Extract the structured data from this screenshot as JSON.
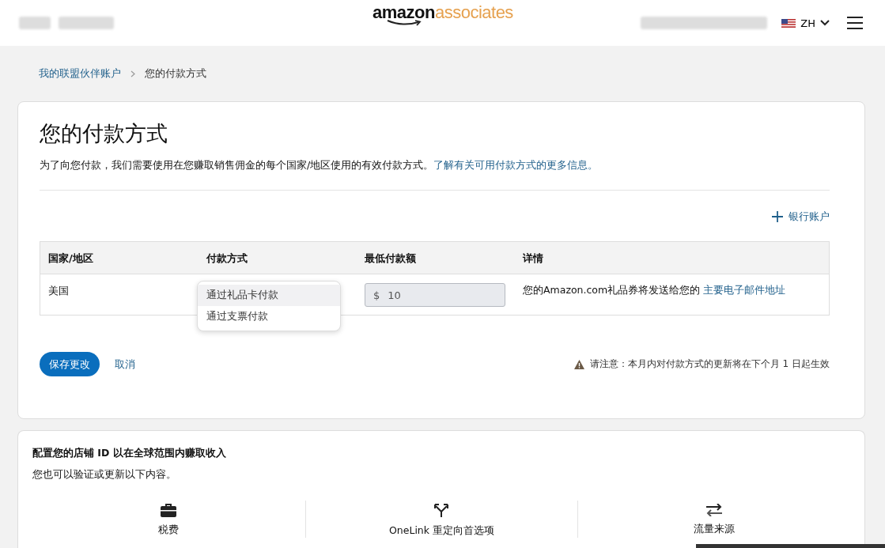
{
  "header": {
    "logo": {
      "brand": "amazon",
      "product": "associates"
    },
    "language": "ZH"
  },
  "breadcrumb": [
    {
      "label": "我的联盟伙伴账户",
      "link": true
    },
    {
      "label": "您的付款方式",
      "link": false
    }
  ],
  "payment_card": {
    "title": "您的付款方式",
    "intro": "为了向您付款，我们需要使用在您赚取销售佣金的每个国家/地区使用的有效付款方式。",
    "intro_link": "了解有关可用付款方式的更多信息。",
    "add_button": "银行账户",
    "table": {
      "columns": [
        "国家/地区",
        "付款方式",
        "最低付款额",
        "详情"
      ],
      "rows": [
        {
          "country": "美国",
          "payment_options": [
            {
              "label": "通过礼品卡付款",
              "selected": true
            },
            {
              "label": "通过支票付款",
              "selected": false
            }
          ],
          "currency": "$",
          "minimum": "10",
          "details": "您的Amazon.com礼品券将发送给您的",
          "details_link": "主要电子邮件地址"
        }
      ]
    },
    "save_button": "保存更改",
    "cancel_link": "取消",
    "notice": "请注意：本月内对付款方式的更新将在下个月 1 日起生效"
  },
  "store_card": {
    "title": "配置您的店铺 ID 以在全球范围内赚取收入",
    "subtitle": "您也可以验证或更新以下内容。",
    "items": [
      {
        "kind": "tax",
        "label": "税费"
      },
      {
        "kind": "onelink",
        "label": "OneLink 重定向首选项"
      },
      {
        "kind": "traffic",
        "label": "流量来源"
      }
    ]
  }
}
